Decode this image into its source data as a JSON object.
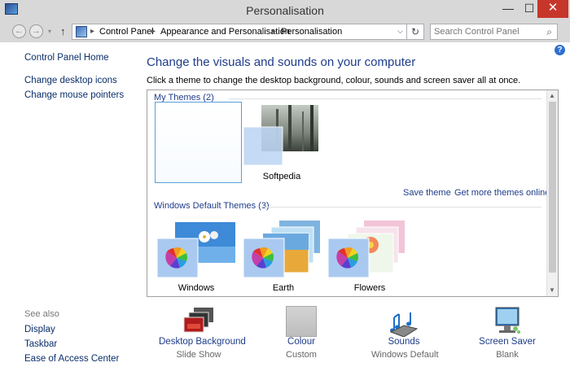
{
  "window": {
    "title": "Personalisation",
    "min_label": "—",
    "max_label": "☐",
    "close_label": "✕"
  },
  "nav": {
    "back_glyph": "←",
    "forward_glyph": "→",
    "dropdown_glyph": "▾",
    "up_glyph": "↑",
    "breadcrumbs": [
      "Control Panel",
      "Appearance and Personalisation",
      "Personalisation"
    ],
    "separator": "▸",
    "address_dropdown_glyph": "⌵",
    "refresh_glyph": "↻",
    "search_placeholder": "Search Control Panel",
    "search_icon": "search-icon"
  },
  "left_nav": {
    "home": "Control Panel Home",
    "links": [
      "Change desktop icons",
      "Change mouse pointers"
    ],
    "see_also_label": "See also",
    "see_also": [
      "Display",
      "Taskbar",
      "Ease of Access Center"
    ]
  },
  "main": {
    "heading": "Change the visuals and sounds on your computer",
    "subheading": "Click a theme to change the desktop background, colour, sounds and screen saver all at once.",
    "help_glyph": "?"
  },
  "themes": {
    "my_themes_label": "My Themes (2)",
    "my_themes": [
      {
        "name": "Softpedia"
      }
    ],
    "save_theme": "Save theme",
    "get_more": "Get more themes online",
    "default_label": "Windows Default Themes (3)",
    "defaults": [
      {
        "name": "Windows"
      },
      {
        "name": "Earth"
      },
      {
        "name": "Flowers"
      }
    ]
  },
  "bottom": [
    {
      "label": "Desktop Background",
      "value": "Slide Show",
      "icon": "desktop-background-icon"
    },
    {
      "label": "Colour",
      "value": "Custom",
      "icon": "colour-icon"
    },
    {
      "label": "Sounds",
      "value": "Windows Default",
      "icon": "sounds-icon"
    },
    {
      "label": "Screen Saver",
      "value": "Blank",
      "icon": "screen-saver-icon"
    }
  ],
  "colors": {
    "link": "#1e3c8a",
    "close_button": "#c7362b",
    "window_frame": "#d8d8d8",
    "selection_border": "#5a9fd6"
  }
}
